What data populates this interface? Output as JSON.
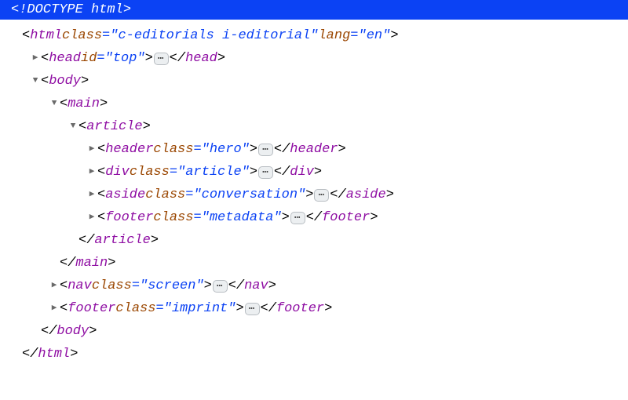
{
  "doctype": "<!DOCTYPE html>",
  "ellipsis": "⋯",
  "root": {
    "open_prefix": "<",
    "name": "html",
    "attr1_name": "class",
    "attr1_val": "c-editorials i-editorial",
    "attr2_name": "lang",
    "attr2_val": "en",
    "close_open": "</",
    "close_name": "html",
    "gt": ">"
  },
  "head": {
    "name": "head",
    "attr_name": "id",
    "attr_val": "top",
    "close_name": "head"
  },
  "body_tag": {
    "name": "body",
    "close_name": "body"
  },
  "main_tag": {
    "name": "main",
    "close_name": "main"
  },
  "article_tag": {
    "name": "article",
    "close_name": "article"
  },
  "header": {
    "name": "header",
    "attr_name": "class",
    "attr_val": "hero",
    "close_name": "header"
  },
  "div": {
    "name": "div",
    "attr_name": "class",
    "attr_val": "article",
    "close_name": "div"
  },
  "aside": {
    "name": "aside",
    "attr_name": "class",
    "attr_val": "conversation",
    "close_name": "aside"
  },
  "footer_meta": {
    "name": "footer",
    "attr_name": "class",
    "attr_val": "metadata",
    "close_name": "footer"
  },
  "nav": {
    "name": "nav",
    "attr_name": "class",
    "attr_val": "screen",
    "close_name": "nav"
  },
  "footer_imp": {
    "name": "footer",
    "attr_name": "class",
    "attr_val": "imprint",
    "close_name": "footer"
  },
  "eq": "=",
  "q": "\"",
  "lt": "<",
  "gt": ">",
  "lts": "</",
  "sp": " "
}
